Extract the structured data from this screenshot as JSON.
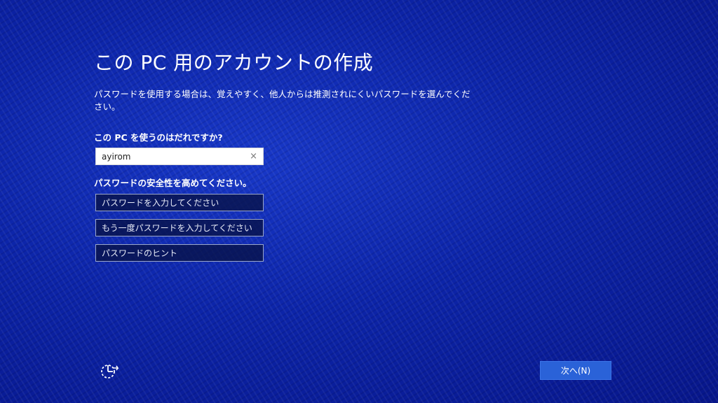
{
  "page": {
    "title": "この PC 用のアカウントの作成",
    "description": "パスワードを使用する場合は、覚えやすく、他人からは推測されにくいパスワードを選んでください。"
  },
  "user_section": {
    "label": "この PC を使うのはだれですか?",
    "username_value": "ayirom",
    "clear_icon": "×"
  },
  "password_section": {
    "label": "パスワードの安全性を高めてください。",
    "password_placeholder": "パスワードを入力してください",
    "confirm_placeholder": "もう一度パスワードを入力してください",
    "hint_placeholder": "パスワードのヒント"
  },
  "footer": {
    "next_label": "次へ(N)",
    "ease_of_access_icon": "ease-of-access-icon"
  },
  "colors": {
    "background": "#0a1f9e",
    "button": "#2a62d8",
    "text": "#ffffff"
  }
}
